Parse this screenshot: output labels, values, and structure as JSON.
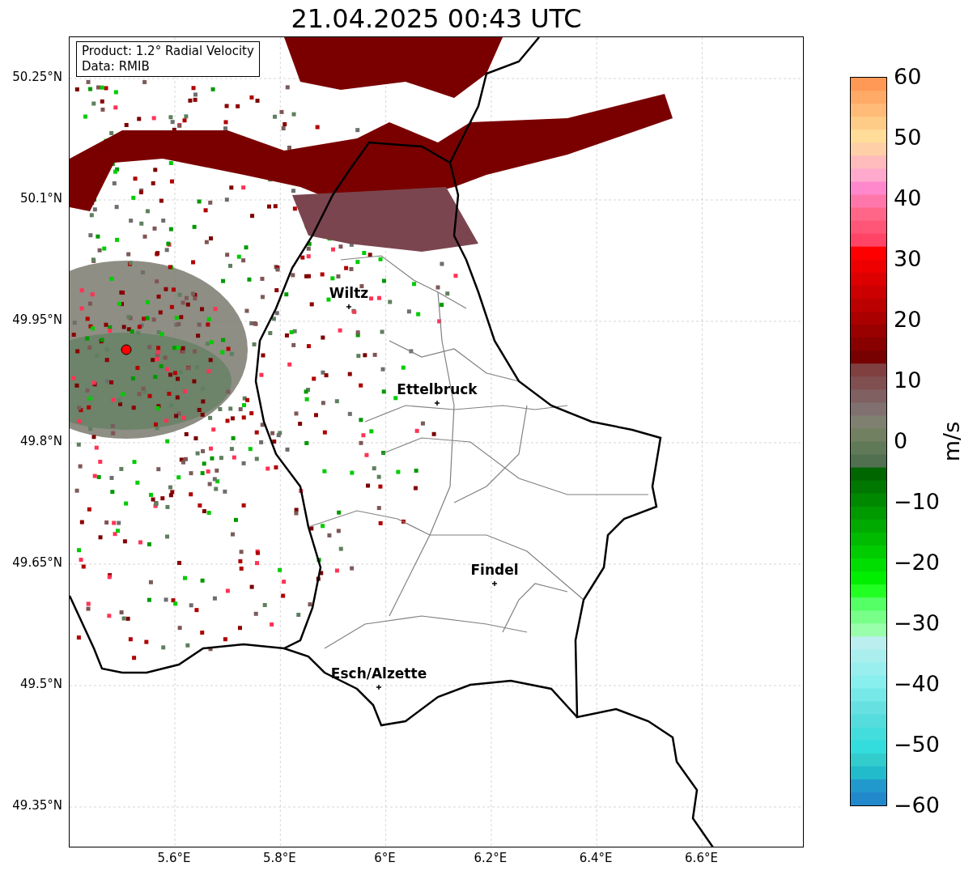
{
  "title": "21.04.2025 00:43 UTC",
  "info_box": [
    "Product: 1.2° Radial Velocity",
    "Data: RMIB"
  ],
  "y_ticks": [
    "50.25°N",
    "50.1°N",
    "49.95°N",
    "49.8°N",
    "49.65°N",
    "49.5°N",
    "49.35°N"
  ],
  "x_ticks": [
    "5.6°E",
    "5.8°E",
    "6°E",
    "6.2°E",
    "6.4°E",
    "6.6°E"
  ],
  "places": [
    {
      "name": "Wiltz"
    },
    {
      "name": "Ettelbruck"
    },
    {
      "name": "Findel"
    },
    {
      "name": "Esch/Alzette"
    }
  ],
  "colorbar": {
    "label": "m/s",
    "ticks": [
      "60",
      "50",
      "40",
      "30",
      "20",
      "10",
      "0",
      "−10",
      "−20",
      "−30",
      "−40",
      "−50",
      "−60"
    ]
  }
}
